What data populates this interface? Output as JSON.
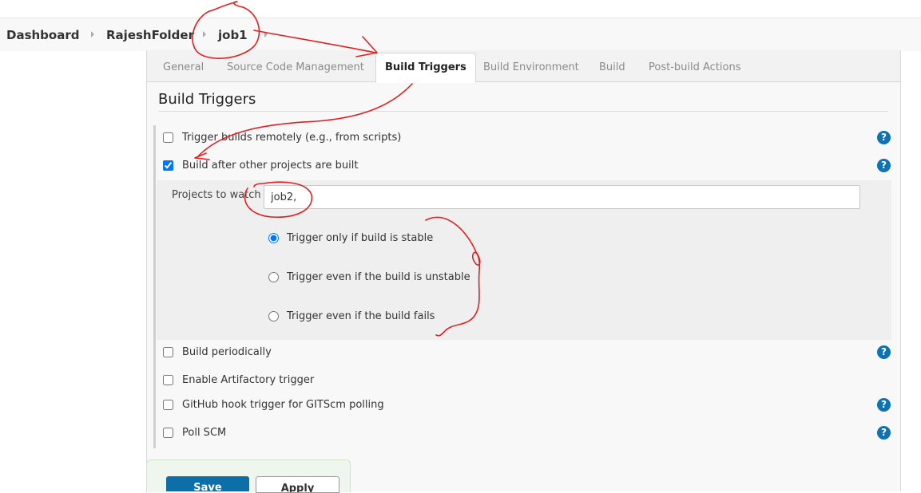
{
  "breadcrumb": {
    "items": [
      "Dashboard",
      "RajeshFolder",
      "job1"
    ]
  },
  "tabs": [
    "General",
    "Source Code Management",
    "Build Triggers",
    "Build Environment",
    "Build",
    "Post-build Actions"
  ],
  "active_tab": "Build Triggers",
  "section": {
    "title": "Build Triggers"
  },
  "triggers": {
    "remote": {
      "label": "Trigger builds remotely (e.g., from scripts)",
      "checked": false
    },
    "after_other": {
      "label": "Build after other projects are built",
      "checked": true
    },
    "projects_to_watch_label": "Projects to watch",
    "projects_to_watch_value": "job2,",
    "radio_options": [
      {
        "label": "Trigger only if build is stable",
        "selected": true
      },
      {
        "label": "Trigger even if the build is unstable",
        "selected": false
      },
      {
        "label": "Trigger even if the build fails",
        "selected": false
      }
    ],
    "periodically": {
      "label": "Build periodically",
      "checked": false
    },
    "artifactory": {
      "label": "Enable Artifactory trigger",
      "checked": false
    },
    "github_hook": {
      "label": "GitHub hook trigger for GITScm polling",
      "checked": false
    },
    "poll_scm": {
      "label": "Poll SCM",
      "checked": false
    }
  },
  "help_glyph": "?",
  "buttons": {
    "save": "Save",
    "apply": "Apply"
  },
  "colors": {
    "accent": "#0d73b5",
    "annotation": "#e02020"
  },
  "icons": [
    "chevron-right-icon",
    "help-icon"
  ]
}
